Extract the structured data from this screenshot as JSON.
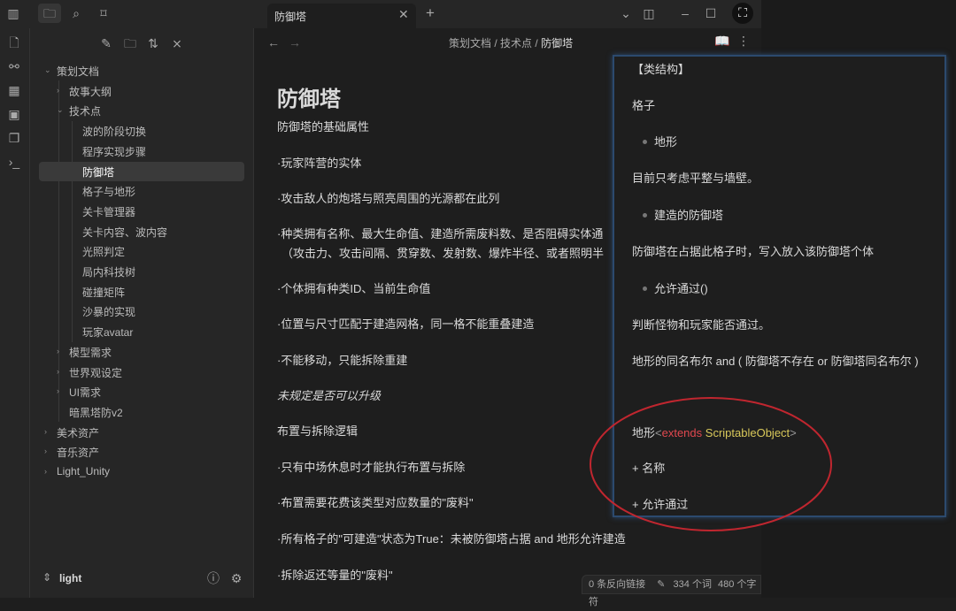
{
  "titlebar": {
    "tab_title": "防御塔",
    "new_tab": "+"
  },
  "file_tree": {
    "items": [
      {
        "label": "策划文档",
        "level": 0,
        "chev": "⌄"
      },
      {
        "label": "故事大纲",
        "level": 1,
        "chev": "›"
      },
      {
        "label": "技术点",
        "level": 1,
        "chev": "⌄"
      },
      {
        "label": "波的阶段切换",
        "level": 2
      },
      {
        "label": "程序实现步骤",
        "level": 2
      },
      {
        "label": "防御塔",
        "level": 2
      },
      {
        "label": "格子与地形",
        "level": 2
      },
      {
        "label": "关卡管理器",
        "level": 2
      },
      {
        "label": "关卡内容、波内容",
        "level": 2
      },
      {
        "label": "光照判定",
        "level": 2
      },
      {
        "label": "局内科技树",
        "level": 2
      },
      {
        "label": "碰撞矩阵",
        "level": 2
      },
      {
        "label": "沙暴的实现",
        "level": 2
      },
      {
        "label": "玩家avatar",
        "level": 2
      },
      {
        "label": "模型需求",
        "level": 1,
        "chev": "›"
      },
      {
        "label": "世界观设定",
        "level": 1,
        "chev": "›"
      },
      {
        "label": "UI需求",
        "level": 1,
        "chev": "›"
      },
      {
        "label": "暗黑塔防v2",
        "level": 1
      },
      {
        "label": "美术资产",
        "level": 0,
        "chev": "›"
      },
      {
        "label": "音乐资产",
        "level": 0,
        "chev": "›"
      },
      {
        "label": "Light_Unity",
        "level": 0,
        "chev": "›"
      }
    ],
    "vault_name": "light"
  },
  "breadcrumb": {
    "a": "策划文档",
    "b": "技术点",
    "c": "防御塔",
    "sep": "/"
  },
  "note": {
    "title": "防御塔",
    "lines": [
      "防御塔的基础属性",
      "·玩家阵营的实体",
      "·攻击敌人的炮塔与照亮周围的光源都在此列",
      "·种类拥有名称、最大生命值、建造所需废料数、是否阻碍实体通",
      "（攻击力、攻击间隔、贯穿数、发射数、爆炸半径、或者照明半",
      "·个体拥有种类ID、当前生命值",
      "·位置与尺寸匹配于建造网格，同一格不能重叠建造",
      "·不能移动，只能拆除重建",
      "未规定是否可以升级",
      "布置与拆除逻辑",
      "·只有中场休息时才能执行布置与拆除",
      "·布置需要花费该类型对应数量的\"废料\"",
      "·所有格子的\"可建造\"状态为True：未被防御塔占据 and 地形允许建造",
      "·拆除返还等量的\"废料\""
    ]
  },
  "popup": {
    "heading": "【类结构】",
    "grid": "格子",
    "b1": "地形",
    "t1": "目前只考虑平整与墙壁。",
    "b2": "建造的防御塔",
    "t2": "防御塔在占据此格子时，写入放入该防御塔个体",
    "b3": "允许通过()",
    "t3": "判断怪物和玩家能否通过。",
    "t4": "地形的同名布尔 and ( 防御塔不存在 or 防御塔同名布尔 )",
    "cls_name": "地形",
    "lt": "<",
    "kw": "extends",
    "type": "ScriptableObject",
    "gt": ">",
    "f1": "+ 名称",
    "f2": "+ 允许通过"
  },
  "status": {
    "backlinks": "0 条反向链接",
    "words": "334 个词",
    "chars": "480 个字符"
  },
  "colors": {
    "accent": "#2c4a6e",
    "annotation": "#c0262f",
    "keyword": "#e0484f",
    "type": "#d8c85a"
  }
}
